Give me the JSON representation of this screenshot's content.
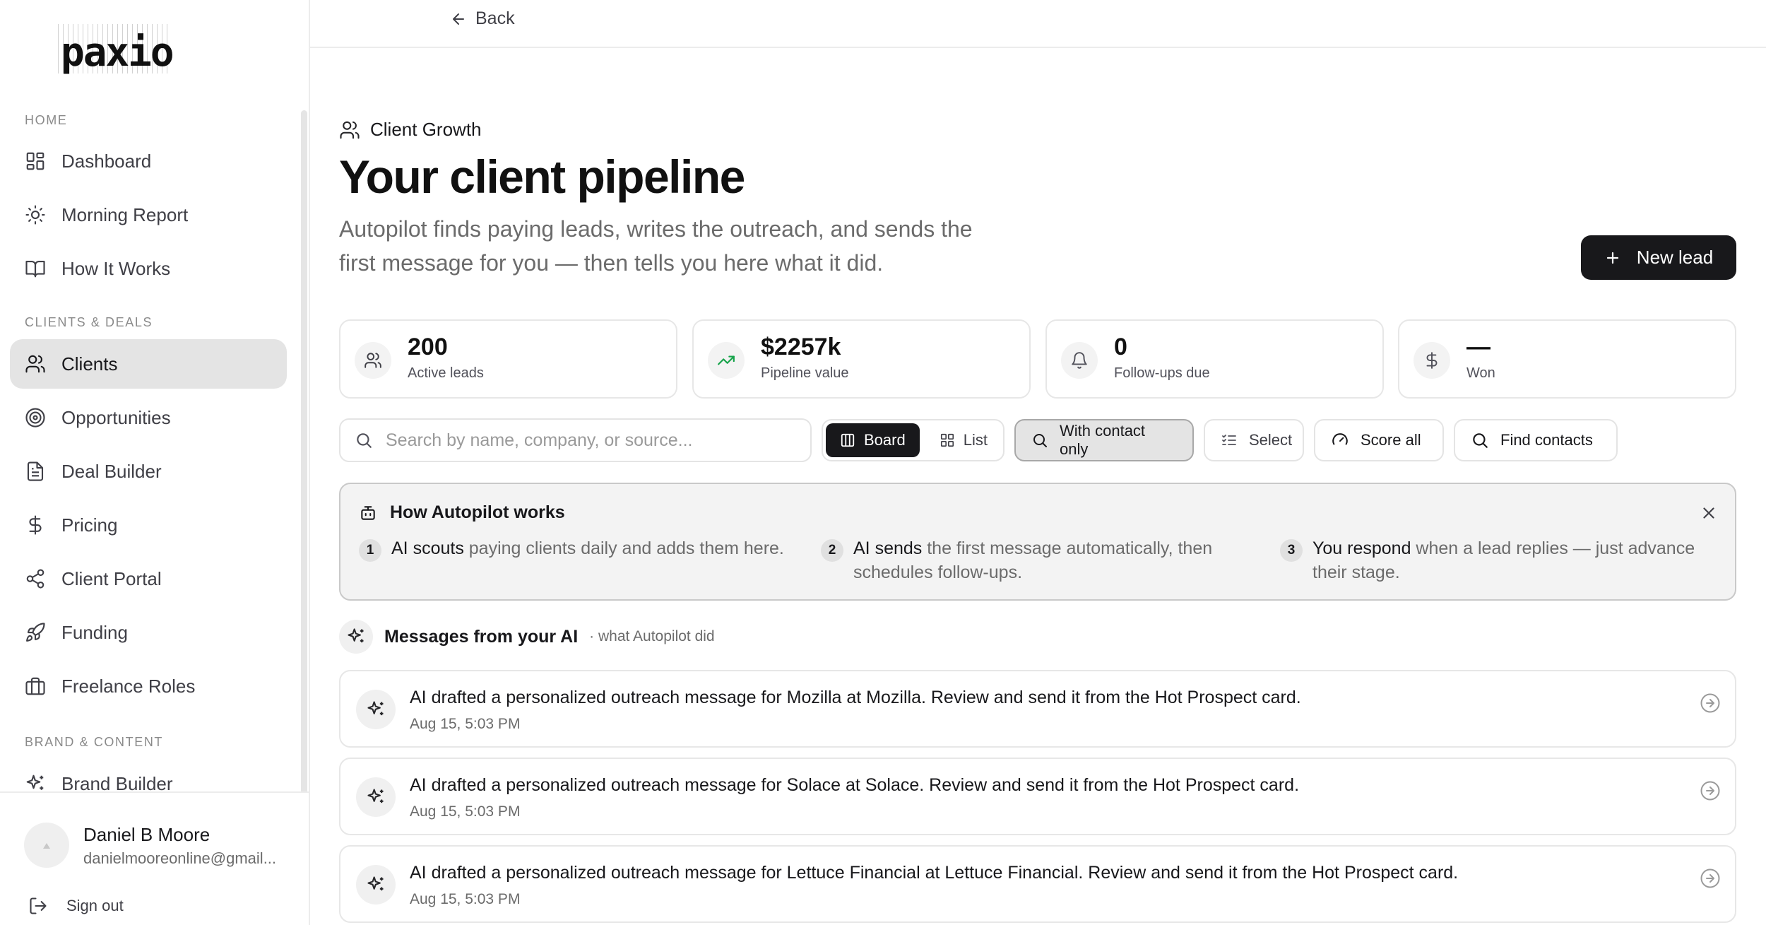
{
  "brand": {
    "logo_text": "paxio"
  },
  "sidebar": {
    "sections": [
      {
        "label": "HOME"
      },
      {
        "label": "CLIENTS & DEALS"
      },
      {
        "label": "BRAND & CONTENT"
      }
    ],
    "items": [
      {
        "label": "Dashboard",
        "icon": "dashboard-icon"
      },
      {
        "label": "Morning Report",
        "icon": "sun-icon"
      },
      {
        "label": "How It Works",
        "icon": "book-icon"
      },
      {
        "label": "Clients",
        "icon": "users-icon",
        "active": true
      },
      {
        "label": "Opportunities",
        "icon": "target-icon"
      },
      {
        "label": "Deal Builder",
        "icon": "document-icon"
      },
      {
        "label": "Pricing",
        "icon": "dollar-icon"
      },
      {
        "label": "Client Portal",
        "icon": "share-icon"
      },
      {
        "label": "Funding",
        "icon": "rocket-icon"
      },
      {
        "label": "Freelance Roles",
        "icon": "briefcase-icon"
      },
      {
        "label": "Brand Builder",
        "icon": "sparkles-icon"
      }
    ],
    "user": {
      "name": "Daniel B Moore",
      "email": "danielmooreonline@gmail..."
    },
    "signout_label": "Sign out"
  },
  "topbar": {
    "back_label": "Back"
  },
  "header": {
    "eyebrow": "Client Growth",
    "title": "Your client pipeline",
    "subtitle": "Autopilot finds paying leads, writes the outreach, and sends the first message for you — then tells you here what it did.",
    "new_lead_label": "New lead"
  },
  "stats": [
    {
      "value": "200",
      "label": "Active leads",
      "icon": "users-icon"
    },
    {
      "value": "$2257k",
      "label": "Pipeline value",
      "icon": "trending-up-icon"
    },
    {
      "value": "0",
      "label": "Follow-ups due",
      "icon": "bell-icon"
    },
    {
      "value": "—",
      "label": "Won",
      "icon": "dollar-icon"
    }
  ],
  "toolbar": {
    "search_placeholder": "Search by name, company, or source...",
    "view_board": "Board",
    "view_list": "List",
    "with_contact_only": "With contact only",
    "select": "Select",
    "score_all": "Score all",
    "find_contacts": "Find contacts"
  },
  "howto": {
    "title": "How Autopilot works",
    "steps": [
      {
        "num": "1",
        "bold": "AI scouts",
        "text": " paying clients daily and adds them here."
      },
      {
        "num": "2",
        "bold": "AI sends",
        "text": " the first message automatically, then schedules follow-ups."
      },
      {
        "num": "3",
        "bold": "You respond",
        "text": " when a lead replies — just advance their stage."
      }
    ]
  },
  "messages": {
    "title": "Messages from your AI",
    "subtitle": "· what Autopilot did",
    "items": [
      {
        "text": "AI drafted a personalized outreach message for Mozilla at Mozilla. Review and send it from the Hot Prospect card.",
        "time": "Aug 15, 5:03 PM"
      },
      {
        "text": "AI drafted a personalized outreach message for Solace at Solace. Review and send it from the Hot Prospect card.",
        "time": "Aug 15, 5:03 PM"
      },
      {
        "text": "AI drafted a personalized outreach message for Lettuce Financial at Lettuce Financial. Review and send it from the Hot Prospect card.",
        "time": "Aug 15, 5:03 PM"
      }
    ]
  }
}
